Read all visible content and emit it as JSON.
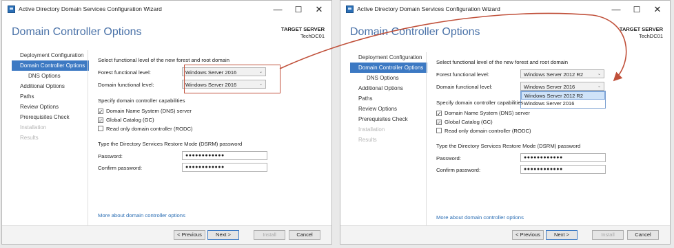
{
  "window_title": "Active Directory Domain Services Configuration Wizard",
  "window_controls": {
    "minimize": "—",
    "maximize": "☐",
    "close": "✕"
  },
  "page_heading": "Domain Controller Options",
  "target_server": {
    "label": "TARGET SERVER",
    "name": "TechDC01"
  },
  "nav": [
    {
      "label": "Deployment Configuration",
      "state": "normal"
    },
    {
      "label": "Domain Controller Options",
      "state": "active"
    },
    {
      "label": "DNS Options",
      "state": "sub"
    },
    {
      "label": "Additional Options",
      "state": "normal"
    },
    {
      "label": "Paths",
      "state": "normal"
    },
    {
      "label": "Review Options",
      "state": "normal"
    },
    {
      "label": "Prerequisites Check",
      "state": "normal"
    },
    {
      "label": "Installation",
      "state": "disabled"
    },
    {
      "label": "Results",
      "state": "disabled"
    }
  ],
  "form": {
    "functional_level_heading": "Select functional level of the new forest and root domain",
    "forest_label": "Forest functional level:",
    "domain_label": "Domain functional level:",
    "capabilities_heading": "Specify domain controller capabilities",
    "dns_label": "Domain Name System (DNS) server",
    "gc_label": "Global Catalog (GC)",
    "rodc_label": "Read only domain controller (RODC)",
    "dsrm_heading": "Type the Directory Services Restore Mode (DSRM) password",
    "password_label": "Password:",
    "confirm_label": "Confirm password:",
    "password_mask": "●●●●●●●●●●●●",
    "confirm_mask": "●●●●●●●●●●●●",
    "more_link": "More about domain controller options",
    "check_mark": "✓"
  },
  "left_window": {
    "forest_value": "Windows Server 2016",
    "domain_value": "Windows Server 2016"
  },
  "right_window": {
    "forest_value": "Windows Server 2012 R2",
    "domain_value": "Windows Server 2016",
    "dropdown_options": [
      "Windows Server 2012 R2",
      "Windows Server 2016"
    ]
  },
  "buttons": {
    "previous": "< Previous",
    "next": "Next >",
    "install": "Install",
    "cancel": "Cancel"
  },
  "combo_arrow": "⌄",
  "colors": {
    "accent": "#3c79c3",
    "heading": "#4a72a8",
    "annotation": "#c0503a",
    "link": "#2a6db3"
  }
}
